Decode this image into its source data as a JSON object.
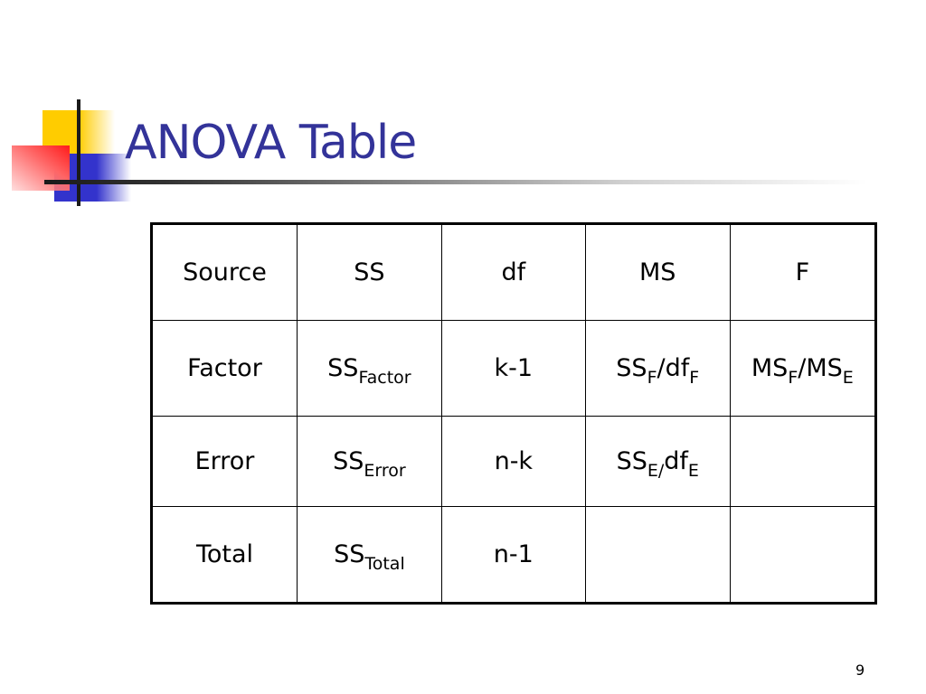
{
  "slide": {
    "title": "ANOVA Table",
    "page_number": "9",
    "title_color": "#333399",
    "decoration_colors": {
      "yellow": "#ffcc00",
      "blue": "#3333cc",
      "red": "#ff1a1a",
      "line": "#1a1a1a"
    }
  },
  "table": {
    "headers": [
      "Source",
      "SS",
      "df",
      "MS",
      "F"
    ],
    "rows": [
      {
        "source": "Factor",
        "ss": {
          "main": "SS",
          "sub": "Factor"
        },
        "df": "k-1",
        "ms": {
          "a": "SS",
          "a_sub": "F",
          "sep": "/",
          "b": "df",
          "b_sub": "F"
        },
        "f": {
          "a": "MS",
          "a_sub": "F",
          "sep": "/",
          "b": "MS",
          "b_sub": "E"
        }
      },
      {
        "source": "Error",
        "ss": {
          "main": "SS",
          "sub": "Error"
        },
        "df": "n-k",
        "ms": {
          "a": "SS",
          "a_sub": "E/",
          "sep": "",
          "b": "df",
          "b_sub": "E"
        },
        "f": null
      },
      {
        "source": "Total",
        "ss": {
          "main": "SS",
          "sub": "Total"
        },
        "df": "n-1",
        "ms": null,
        "f": null
      }
    ]
  }
}
